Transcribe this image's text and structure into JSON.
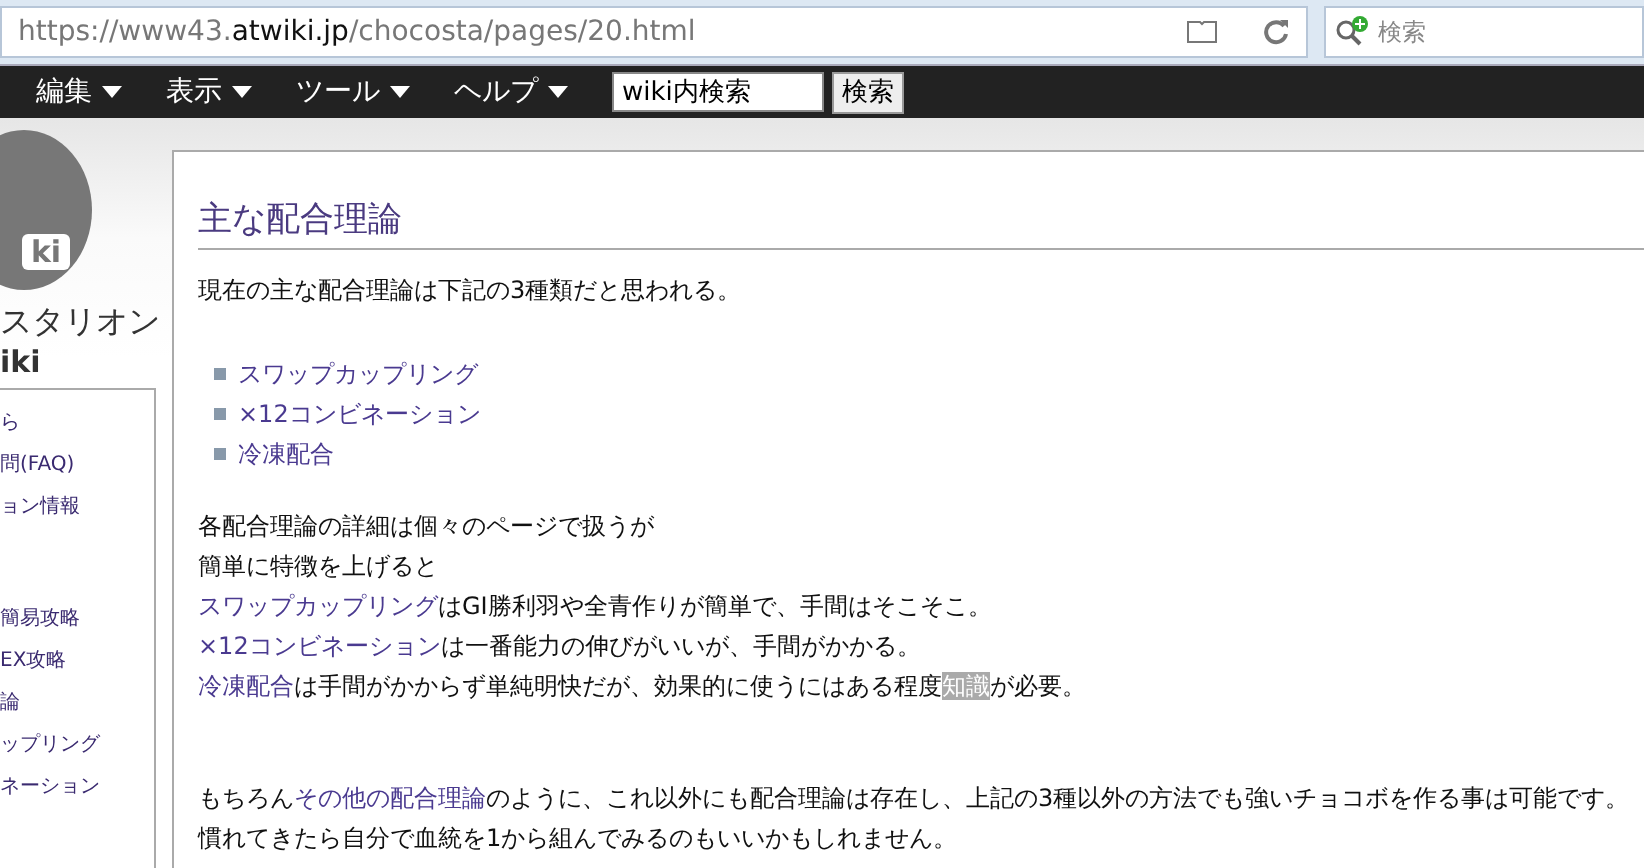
{
  "address_bar": {
    "url_prefix": "https://www43.",
    "url_domain": "atwiki.jp",
    "url_path": "/chocosta/pages/20.html"
  },
  "browser_search": {
    "placeholder": "検索"
  },
  "menubar": {
    "items": [
      {
        "label": "編集"
      },
      {
        "label": "表示"
      },
      {
        "label": "ツール"
      },
      {
        "label": "ヘルプ"
      }
    ],
    "search_value": "wiki内検索",
    "search_button": "検索"
  },
  "sidebar": {
    "logo_text": "ki",
    "site_title": "スタリオン",
    "site_subtitle": "iki",
    "items": [
      {
        "label": "ら"
      },
      {
        "label": "問(FAQ)"
      },
      {
        "label": "ョン情報"
      },
      {
        "label": "簡易攻略"
      },
      {
        "label": "EX攻略"
      },
      {
        "label": "論"
      },
      {
        "label": "ップリング"
      },
      {
        "label": "ネーション"
      }
    ]
  },
  "content": {
    "heading": "主な配合理論",
    "intro": "現在の主な配合理論は下記の3種類だと思われる。",
    "list": [
      "スワップカップリング",
      "×12コンビネーション",
      "冷凍配合"
    ],
    "paragraphs": [
      [
        {
          "kind": "text",
          "text": "各配合理論の詳細は個々のページで扱うが"
        }
      ],
      [
        {
          "kind": "text",
          "text": "簡単に特徴を上げると"
        }
      ],
      [
        {
          "kind": "link",
          "text": "スワップカップリング"
        },
        {
          "kind": "text",
          "text": "はGI勝利羽や全青作りが簡単で、手間はそこそこ。"
        }
      ],
      [
        {
          "kind": "link",
          "text": "×12コンビネーション"
        },
        {
          "kind": "text",
          "text": "は一番能力の伸びがいいが、手間がかかる。"
        }
      ],
      [
        {
          "kind": "link",
          "text": "冷凍配合"
        },
        {
          "kind": "text",
          "text": "は手間がかからず単純明快だが、効果的に使うにはある程度"
        },
        {
          "kind": "highlight",
          "text": "知識"
        },
        {
          "kind": "text",
          "text": "が必要。"
        }
      ]
    ],
    "paragraphs_2": [
      [
        {
          "kind": "text",
          "text": "もちろん"
        },
        {
          "kind": "link",
          "text": "その他の配合理論"
        },
        {
          "kind": "text",
          "text": "のように、これ以外にも配合理論は存在し、上記の3種以外の方法でも強いチョコボを作る事は可能です。"
        }
      ],
      [
        {
          "kind": "text",
          "text": "慣れてきたら自分で血統を1から組んでみるのもいいかもしれません。"
        }
      ]
    ]
  }
}
